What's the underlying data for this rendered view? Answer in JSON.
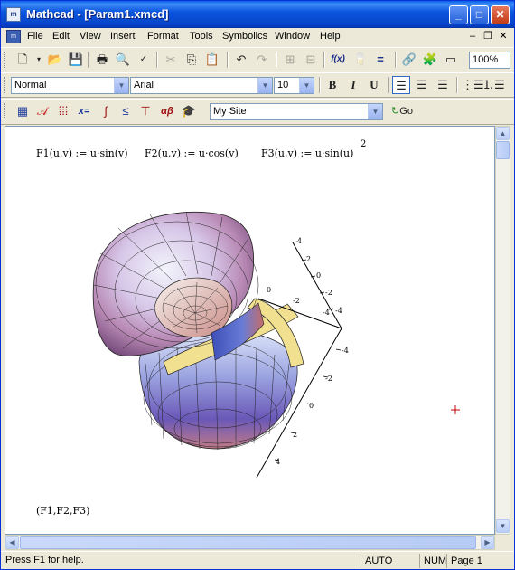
{
  "window": {
    "title": "Mathcad - [Param1.xmcd]",
    "app_icon": "mathcad-icon"
  },
  "menu": {
    "items": [
      "File",
      "Edit",
      "View",
      "Insert",
      "Format",
      "Tools",
      "Symbolics",
      "Window",
      "Help"
    ]
  },
  "toolbar_format": {
    "style": "Normal",
    "font": "Arial",
    "size": "10",
    "bold": "B",
    "italic": "I",
    "underline": "U"
  },
  "toolbar_standard": {
    "zoom": "100%",
    "fx": "f(x)"
  },
  "toolbar_resources": {
    "site": "My Site",
    "go": "Go"
  },
  "document": {
    "definitions": [
      "F1(u,v) := u·sin(v)",
      "F2(u,v) := u·cos(v)",
      "F3(u,v) := u·sin(u)"
    ],
    "exponent": "2",
    "plot_args": "(F1,F2,F3)",
    "axis_y_labels": [
      "4",
      "2",
      "0",
      "-2",
      "-4"
    ],
    "axis_x_labels": [
      "0",
      "-2",
      "-4",
      "-4",
      "-2",
      "0",
      "2",
      "4"
    ]
  },
  "status": {
    "help": "Press F1 for help.",
    "mode": "AUTO",
    "num": "NUM",
    "page": "Page 1"
  },
  "colors": {
    "titlebar": "#0b56df",
    "surface_light": "#f2f4fb",
    "surface_pink": "#c97a8a",
    "surface_blue": "#5a64c8",
    "band": "#f1e090"
  }
}
